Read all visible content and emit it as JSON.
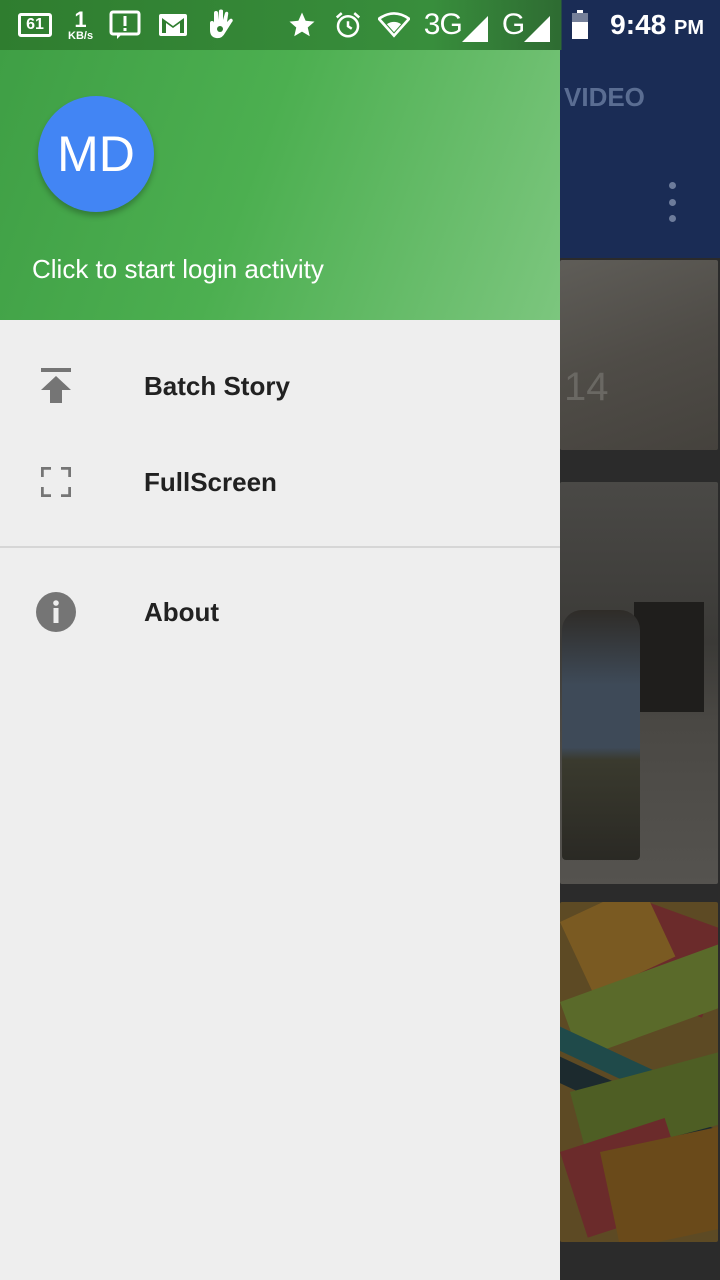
{
  "status_bar": {
    "notification_count": "61",
    "speed_value": "1",
    "speed_unit": "KB/s",
    "network_3g": "3G",
    "network_g": "G",
    "time": "9:48",
    "ampm": "PM",
    "icons": [
      "notification-count-icon",
      "alert-icon",
      "gmail-icon",
      "hand-icon",
      "star-icon",
      "alarm-icon",
      "wifi-icon",
      "signal-icon",
      "battery-icon"
    ]
  },
  "background_app": {
    "tab_label": "VIDEO",
    "card_watermark": "14"
  },
  "drawer": {
    "avatar_initials": "MD",
    "header_text": "Click to start login activity",
    "items": [
      {
        "label": "Batch Story",
        "icon": "upload-icon"
      },
      {
        "label": "FullScreen",
        "icon": "fullscreen-icon"
      },
      {
        "label": "About",
        "icon": "info-icon"
      }
    ]
  },
  "colors": {
    "header_green": "#4caf50",
    "avatar_blue": "#4285f4",
    "drawer_bg": "#eeeeee",
    "toolbar_navy": "#1a2c55"
  }
}
